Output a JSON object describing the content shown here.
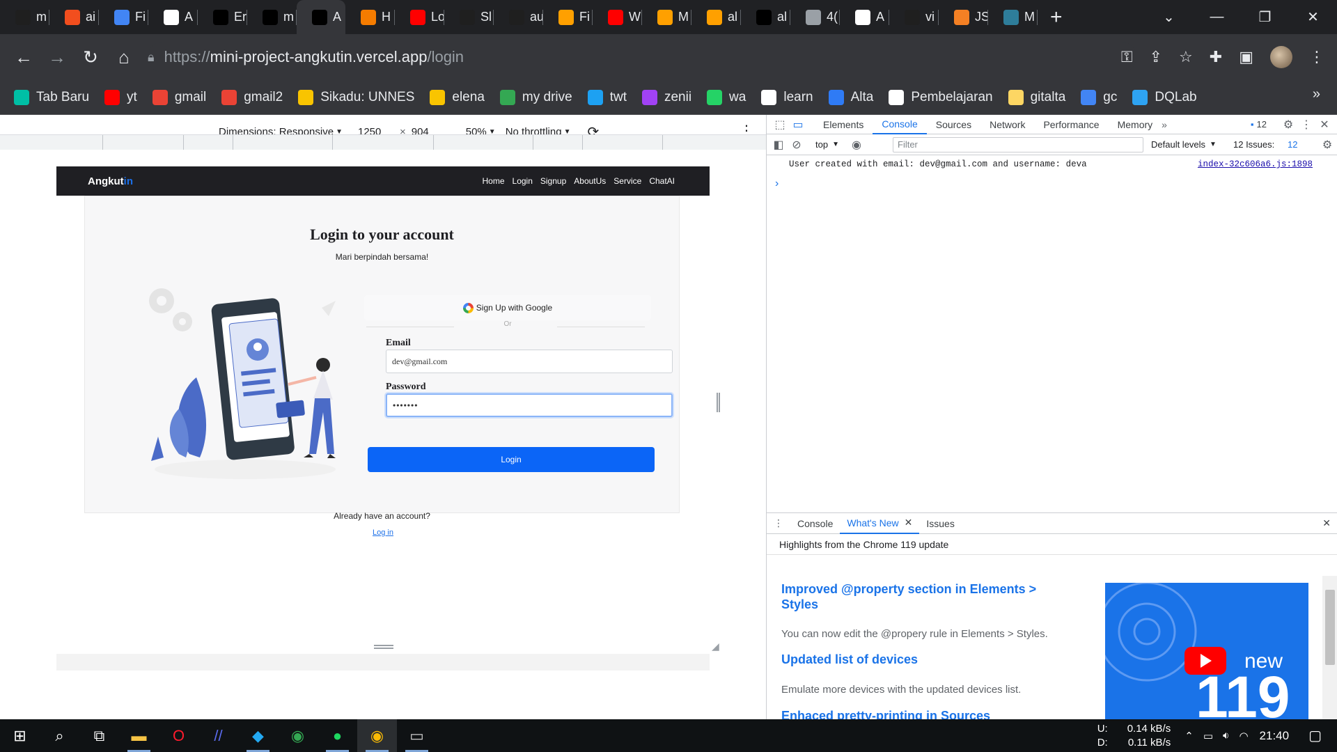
{
  "browser": {
    "tabs": [
      {
        "label": "m",
        "icon": "github-icon",
        "color": "#1f1f1f"
      },
      {
        "label": "ai",
        "icon": "figma-icon",
        "color": "#f24e1e"
      },
      {
        "label": "Fi",
        "icon": "docs-icon",
        "color": "#4285f4"
      },
      {
        "label": "A",
        "icon": "page-icon",
        "color": "#ffffff"
      },
      {
        "label": "Er",
        "icon": "vercel-icon",
        "color": "#000000"
      },
      {
        "label": "m",
        "icon": "vercel-icon",
        "color": "#000000"
      },
      {
        "label": "A",
        "icon": "vercel-icon",
        "color": "#000000",
        "active": true
      },
      {
        "label": "H",
        "icon": "ublock-icon",
        "color": "#f57c00"
      },
      {
        "label": "Lo",
        "icon": "youtube-icon",
        "color": "#ff0000"
      },
      {
        "label": "Sl",
        "icon": "github-icon",
        "color": "#1f1f1f"
      },
      {
        "label": "au",
        "icon": "github-icon",
        "color": "#1f1f1f"
      },
      {
        "label": "Fi",
        "icon": "firebase-icon",
        "color": "#ffa000"
      },
      {
        "label": "W",
        "icon": "youtube-icon",
        "color": "#ff0000"
      },
      {
        "label": "M",
        "icon": "firebase-icon",
        "color": "#ffa000"
      },
      {
        "label": "al",
        "icon": "firebase-icon",
        "color": "#ffa000"
      },
      {
        "label": "al",
        "icon": "vercel-icon",
        "color": "#000000"
      },
      {
        "label": "4(",
        "icon": "globe-icon",
        "color": "#9aa0a6"
      },
      {
        "label": "A",
        "icon": "page-icon",
        "color": "#ffffff"
      },
      {
        "label": "vi",
        "icon": "github-icon",
        "color": "#1f1f1f"
      },
      {
        "label": "JS",
        "icon": "stack-icon",
        "color": "#f48024"
      },
      {
        "label": "M",
        "icon": "mt-icon",
        "color": "#2e7d9a"
      }
    ],
    "url_scheme": "https://",
    "url_host": "mini-project-angkutin.vercel.app",
    "url_path": "/login",
    "bookmarks": [
      {
        "label": "Tab Baru",
        "icon": "m-icon",
        "color": "#00bfa5"
      },
      {
        "label": "yt",
        "icon": "youtube-icon",
        "color": "#ff0000"
      },
      {
        "label": "gmail",
        "icon": "gmail-icon",
        "color": "#ea4335"
      },
      {
        "label": "gmail2",
        "icon": "gmail-icon",
        "color": "#ea4335"
      },
      {
        "label": "Sikadu: UNNES",
        "icon": "unnes-icon",
        "color": "#f9c400"
      },
      {
        "label": "elena",
        "icon": "unnes-icon",
        "color": "#f9c400"
      },
      {
        "label": "my drive",
        "icon": "drive-icon",
        "color": "#34a853"
      },
      {
        "label": "twt",
        "icon": "twitter-icon",
        "color": "#1da1f2"
      },
      {
        "label": "zenii",
        "icon": "zenii-icon",
        "color": "#a142f4"
      },
      {
        "label": "wa",
        "icon": "whatsapp-icon",
        "color": "#25d366"
      },
      {
        "label": "learn",
        "icon": "learn-icon",
        "color": "#ffffff"
      },
      {
        "label": "Alta",
        "icon": "alta-icon",
        "color": "#2f7bf5"
      },
      {
        "label": "Pembelajaran",
        "icon": "notion-icon",
        "color": "#ffffff"
      },
      {
        "label": "gitalta",
        "icon": "folder-icon",
        "color": "#fdd663"
      },
      {
        "label": "gc",
        "icon": "calendar-icon",
        "color": "#4285f4"
      },
      {
        "label": "DQLab",
        "icon": "dqlab-icon",
        "color": "#2ea3f2"
      }
    ]
  },
  "device_toolbar": {
    "dimensions_label": "Dimensions: Responsive",
    "width": "1250",
    "times": "×",
    "height": "904",
    "zoom": "50%",
    "throttling": "No throttling"
  },
  "app": {
    "brand_main": "Angkut",
    "brand_accent": "in",
    "nav": [
      "Home",
      "Login",
      "Signup",
      "AboutUs",
      "Service",
      "ChatAI"
    ],
    "title": "Login to your account",
    "subtitle": "Mari berpindah bersama!",
    "google_label": "Sign Up with Google",
    "or_label": "Or",
    "email_label": "Email",
    "email_value": "dev@gmail.com",
    "password_label": "Password",
    "password_value": "•••••••",
    "login_button": "Login",
    "already_text": "Already have an account?",
    "login_link": "Log in",
    "accent_color": "#0b65f7"
  },
  "devtools": {
    "tabs": [
      "Elements",
      "Console",
      "Sources",
      "Network",
      "Performance",
      "Memory"
    ],
    "active_tab": "Console",
    "issues_count": "12",
    "context": "top",
    "filter_placeholder": "Filter",
    "levels": "Default levels",
    "issues_label": "12 Issues:",
    "issues_badge": "12",
    "console_message": "User created with email: dev@gmail.com and username: deva",
    "console_source": "index-32c606a6.js:1898",
    "drawer_tabs": [
      "Console",
      "What's New",
      "Issues"
    ],
    "drawer_active": "What's New",
    "highlights": "Highlights from the Chrome 119 update",
    "whats_new": [
      {
        "title": "Improved @property section in Elements > Styles",
        "desc": "You can now edit the @propery rule in Elements > Styles."
      },
      {
        "title": "Updated list of devices",
        "desc": "Emulate more devices with the updated devices list."
      },
      {
        "title": "Enhaced pretty-printing in Sources",
        "desc": ""
      }
    ],
    "promo_new": "new",
    "promo_version": "119"
  },
  "taskbar": {
    "upload_label": "U:",
    "download_label": "D:",
    "upload_speed": "0.14 kB/s",
    "download_speed": "0.11 kB/s",
    "time": "21:40"
  }
}
